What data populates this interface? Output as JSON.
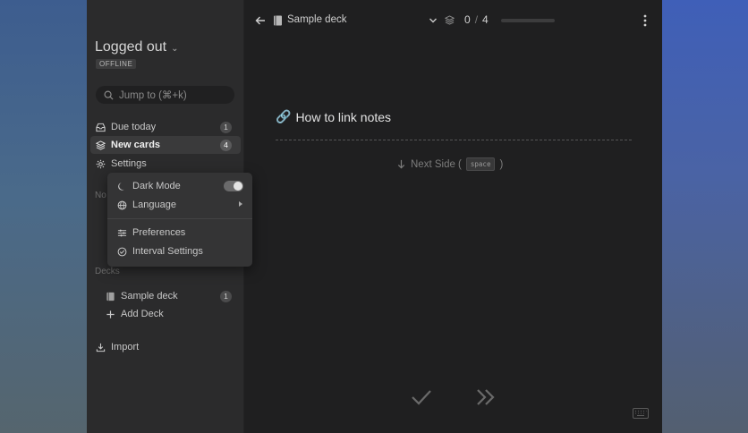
{
  "sidebar": {
    "user": "Logged out",
    "status": "OFFLINE",
    "search_placeholder": "Jump to (⌘+k)",
    "nav": [
      {
        "label": "Due today",
        "badge": "1"
      },
      {
        "label": "New cards",
        "badge": "4"
      },
      {
        "label": "Settings"
      }
    ],
    "notes_label": "No",
    "decks_label": "Decks",
    "decks": [
      {
        "label": "Sample deck",
        "badge": "1"
      }
    ],
    "add_deck": "Add Deck",
    "import": "Import"
  },
  "settings_menu": {
    "dark_mode": "Dark Mode",
    "dark_mode_on": true,
    "language": "Language",
    "preferences": "Preferences",
    "interval_settings": "Interval Settings"
  },
  "topbar": {
    "deck_name": "Sample deck",
    "done": "0",
    "total": "4",
    "progress": 0.0
  },
  "card": {
    "emoji": "🔗",
    "title": "How to link notes",
    "next_side_prefix": "Next Side (",
    "next_side_key": "space",
    "next_side_suffix": ")"
  },
  "colors": {
    "sidebar_bg": "#2b2b2c",
    "main_bg": "#1f1f20",
    "active_item": "#3a3a3b"
  }
}
